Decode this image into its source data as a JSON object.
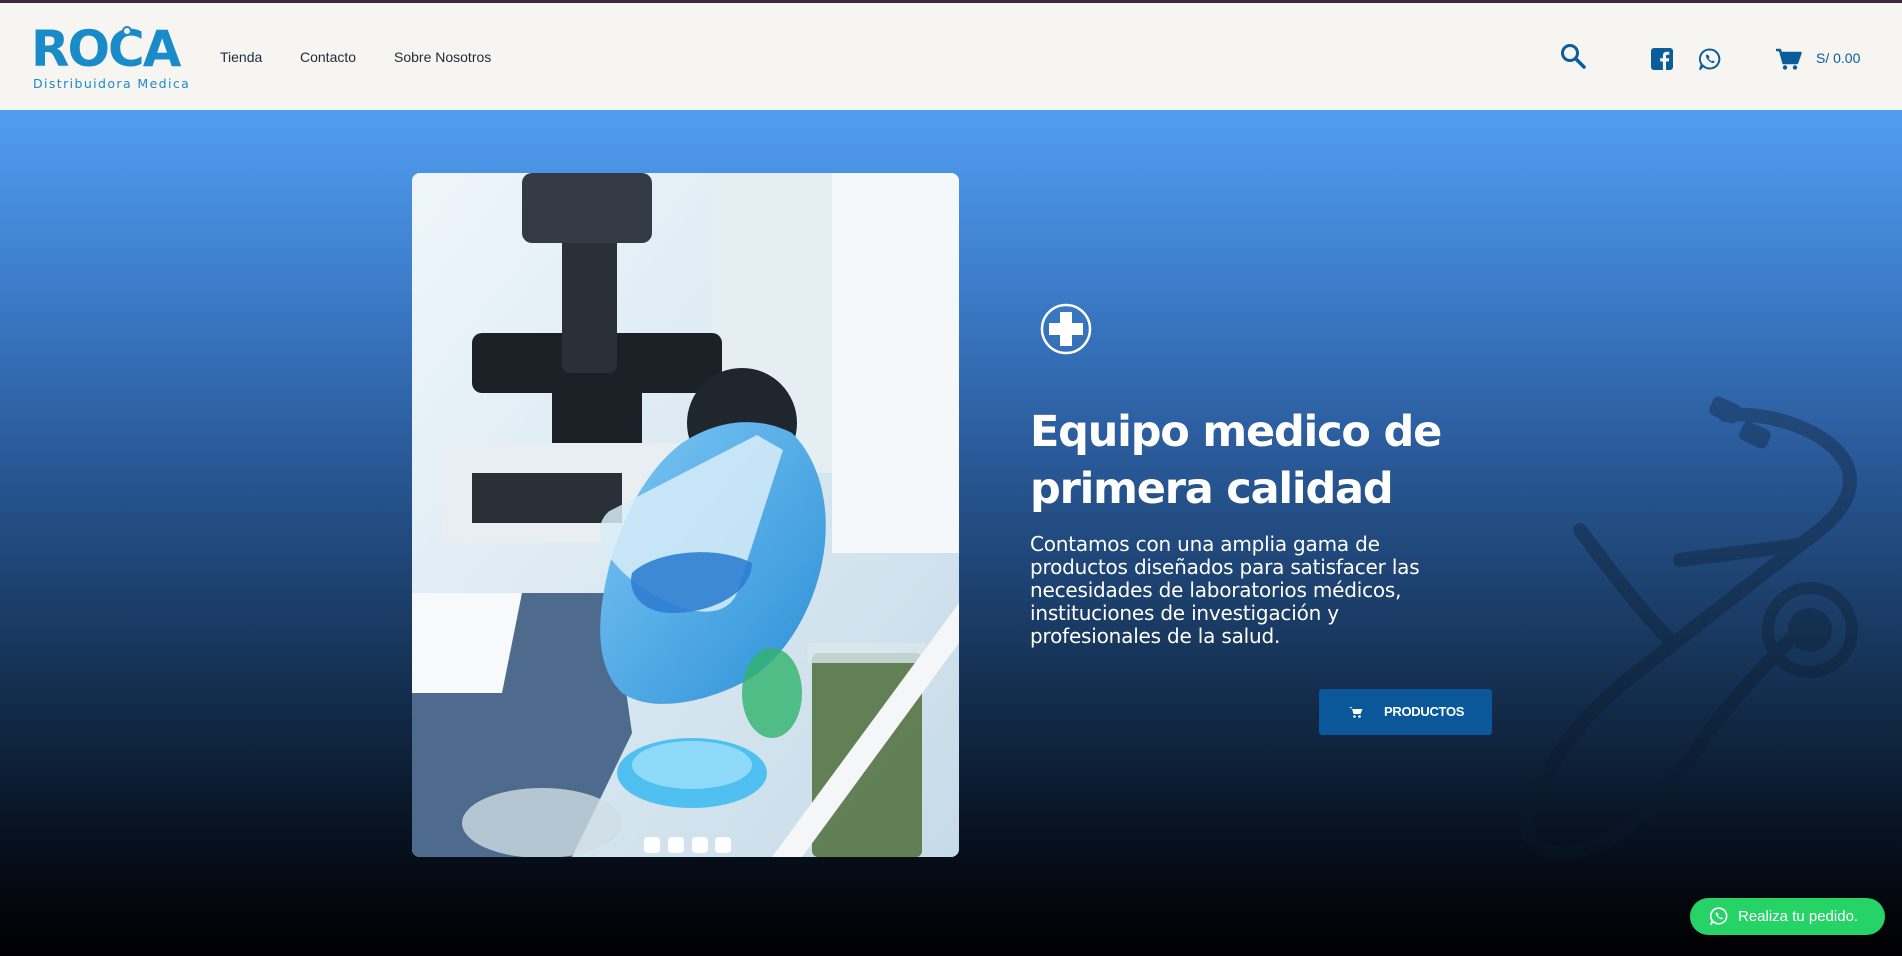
{
  "brand": {
    "name": "ROCA",
    "tagline": "Distribuidora Medica",
    "color": "#1a8bc9"
  },
  "nav": {
    "items": [
      {
        "label": "Tienda"
      },
      {
        "label": "Contacto"
      },
      {
        "label": "Sobre Nosotros"
      }
    ]
  },
  "header_actions": {
    "search_icon": "search-icon",
    "facebook_icon": "facebook-icon",
    "whatsapp_icon": "whatsapp-icon",
    "cart_icon": "cart-icon",
    "cart_total": "S/ 0.00"
  },
  "hero": {
    "icon": "medical-cross-icon",
    "title": "Equipo medico de primera calidad",
    "description": "Contamos con una amplia gama de productos diseñados para satisfacer las necesidades de laboratorios médicos, instituciones de investigación y profesionales de la salud.",
    "cta_label": "PRODUCTOS",
    "cta_icon": "cart-icon",
    "slider_image": "laboratory-scientist-photo",
    "slider_dots": 4
  },
  "floating_whatsapp": {
    "label": "Realiza tu pedido.",
    "icon": "whatsapp-icon",
    "color": "#25d366"
  },
  "colors": {
    "header_bg": "#f7f5f2",
    "accent": "#0a5799",
    "hero_top": "#529ef0",
    "hero_bottom": "#000000"
  }
}
